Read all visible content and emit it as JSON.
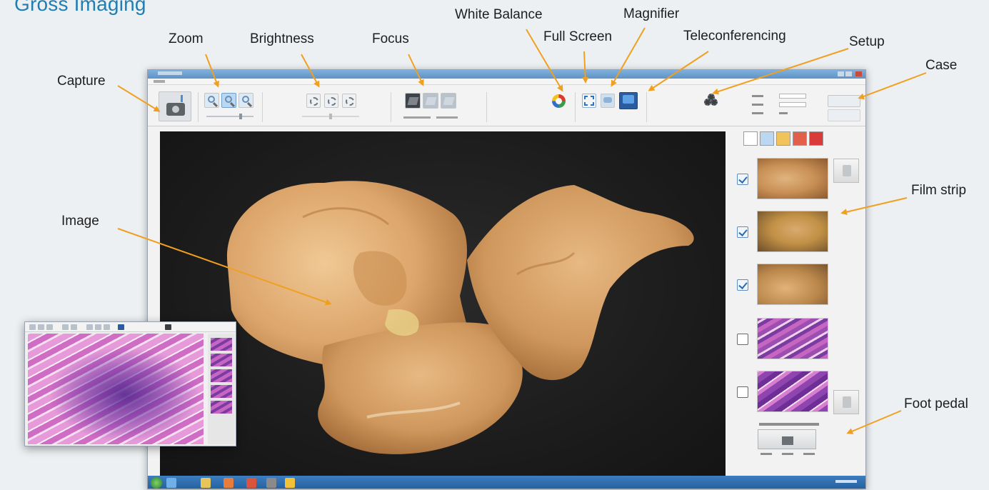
{
  "heading": "Gross Imaging",
  "callouts": {
    "capture": "Capture",
    "zoom": "Zoom",
    "brightness": "Brightness",
    "focus": "Focus",
    "white_balance": "White Balance",
    "full_screen": "Full Screen",
    "magnifier": "Magnifier",
    "teleconferencing": "Teleconferencing",
    "setup": "Setup",
    "case": "Case",
    "image": "Image",
    "film_strip": "Film strip",
    "foot_pedal": "Foot pedal"
  },
  "colors": {
    "heading": "#1f7fb3",
    "arrow": "#f0a020",
    "image_background": "#1a1a1a",
    "taskbar": "#2f6fae"
  },
  "toolbar": {
    "capture_icon": "camera-icon",
    "zoom_icons": [
      "zoom-out-icon",
      "zoom-fit-icon",
      "zoom-in-icon"
    ],
    "brightness_icons": [
      "brightness-down-icon",
      "brightness-auto-icon",
      "brightness-up-icon"
    ],
    "focus_icons": [
      "focus-near-icon",
      "focus-auto-icon",
      "focus-far-icon"
    ],
    "white_balance_icon": "color-wheel-icon",
    "full_screen_icon": "expand-icon",
    "magnifier_icon": "magnifier-icon",
    "teleconferencing_icon": "monitor-icon",
    "setup_icon": "gears-icon"
  },
  "film_strip": {
    "items": [
      {
        "checked": true,
        "content": "gross specimen"
      },
      {
        "checked": true,
        "content": "gross specimen"
      },
      {
        "checked": true,
        "content": "gross specimen"
      },
      {
        "checked": false,
        "content": "histology slide"
      },
      {
        "checked": false,
        "content": "histology slide"
      }
    ]
  }
}
